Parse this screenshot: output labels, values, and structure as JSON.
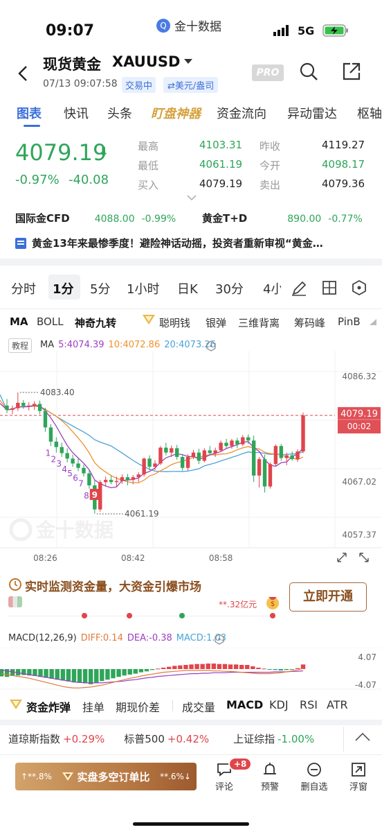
{
  "status_bar": {
    "time": "09:07",
    "app_name": "金十数据",
    "network": "5G"
  },
  "header": {
    "title": "现货黄金",
    "symbol": "XAUUSD",
    "datetime": "07/13 09:07:58",
    "trading_status": "交易中",
    "unit": "⇄美元/盎司",
    "pro_badge": "PRO"
  },
  "tabs": [
    "图表",
    "快讯",
    "头条",
    "盯盘神器",
    "资金流向",
    "异动雷达",
    "枢轴"
  ],
  "quote": {
    "price": "4079.19",
    "change_pct": "-0.97%",
    "change": "-40.08",
    "stats": [
      {
        "label": "最高",
        "value": "4103.31",
        "color": "green"
      },
      {
        "label": "昨收",
        "value": "4119.27",
        "color": "dark"
      },
      {
        "label": "最低",
        "value": "4061.19",
        "color": "green"
      },
      {
        "label": "今开",
        "value": "4098.17",
        "color": "green"
      },
      {
        "label": "买入",
        "value": "4079.19",
        "color": "dark"
      },
      {
        "label": "卖出",
        "value": "4079.36",
        "color": "dark"
      }
    ]
  },
  "related": [
    {
      "name": "国际金CFD",
      "price": "4088.00",
      "pct": "-0.99%"
    },
    {
      "name": "黄金T+D",
      "price": "890.00",
      "pct": "-0.77%"
    }
  ],
  "news_ticker": "黄金13年来最惨季度！避险神话动摇，投资者重新审视“黄金…",
  "timeframes": [
    "分时",
    "1分",
    "5分",
    "1小时",
    "日K",
    "30分",
    "4小"
  ],
  "active_timeframe": "1分",
  "indicators": [
    "MA",
    "BOLL",
    "神奇九转",
    "聪明钱",
    "银弹",
    "三维背离",
    "筹码峰",
    "PinB"
  ],
  "ma_legend": {
    "tutorial": "教程",
    "label": "MA",
    "ma5": "5:4074.39",
    "ma10": "10:4072.86",
    "ma20": "20:4073.26"
  },
  "chart_data": {
    "type": "candlestick",
    "timeframe": "1分",
    "x_ticks": [
      "08:26",
      "08:42",
      "08:58"
    ],
    "y_ticks": [
      "4086.32",
      "4067.02",
      "4057.37"
    ],
    "ylim": [
      4055.0,
      4091.0
    ],
    "current_price": "4079.19",
    "countdown": "00:02",
    "marked_high": "4083.40",
    "marked_low": "4061.19",
    "td_sequence_labels": [
      "1",
      "2",
      "3",
      "4",
      "5",
      "6",
      "7",
      "8",
      "9"
    ],
    "colors": {
      "up": "#e0454b",
      "down": "#2fa55a",
      "ma5": "#9b3fc0",
      "ma10": "#f0902c",
      "ma20": "#4aa3d8"
    },
    "candles": [
      [
        4081.0,
        4082.2,
        4079.6,
        4080.2
      ],
      [
        4080.2,
        4081.0,
        4079.4,
        4080.5
      ],
      [
        4080.5,
        4083.4,
        4080.0,
        4081.5
      ],
      [
        4081.5,
        4082.0,
        4080.4,
        4080.9
      ],
      [
        4080.9,
        4081.6,
        4080.1,
        4081.0
      ],
      [
        4081.0,
        4081.8,
        4080.2,
        4081.3
      ],
      [
        4081.3,
        4081.9,
        4079.4,
        4080.0
      ],
      [
        4080.0,
        4080.6,
        4076.2,
        4077.0
      ],
      [
        4077.0,
        4077.6,
        4073.6,
        4074.4
      ],
      [
        4074.4,
        4075.2,
        4072.4,
        4073.4
      ],
      [
        4073.4,
        4074.2,
        4071.6,
        4072.3
      ],
      [
        4072.3,
        4073.2,
        4070.6,
        4071.3
      ],
      [
        4071.3,
        4072.0,
        4069.8,
        4070.4
      ],
      [
        4070.4,
        4071.3,
        4069.0,
        4069.6
      ],
      [
        4069.6,
        4070.2,
        4068.0,
        4068.6
      ],
      [
        4068.6,
        4069.2,
        4065.8,
        4066.4
      ],
      [
        4066.4,
        4067.3,
        4061.2,
        4062.0
      ],
      [
        4062.0,
        4067.4,
        4061.6,
        4067.0
      ],
      [
        4067.0,
        4068.0,
        4066.2,
        4067.4
      ],
      [
        4067.4,
        4068.2,
        4066.6,
        4067.0
      ],
      [
        4067.0,
        4068.0,
        4066.1,
        4067.2
      ],
      [
        4067.2,
        4068.4,
        4066.7,
        4067.9
      ],
      [
        4067.9,
        4068.5,
        4066.4,
        4067.4
      ],
      [
        4067.4,
        4068.3,
        4066.6,
        4067.9
      ],
      [
        4067.9,
        4068.8,
        4067.0,
        4068.4
      ],
      [
        4068.4,
        4071.5,
        4068.0,
        4071.3
      ],
      [
        4071.3,
        4071.9,
        4069.2,
        4069.8
      ],
      [
        4069.8,
        4071.0,
        4069.2,
        4070.4
      ],
      [
        4070.4,
        4073.6,
        4070.1,
        4073.3
      ],
      [
        4073.3,
        4074.2,
        4071.9,
        4072.4
      ],
      [
        4072.4,
        4073.7,
        4071.6,
        4073.2
      ],
      [
        4073.2,
        4073.8,
        4071.1,
        4071.6
      ],
      [
        4071.6,
        4072.1,
        4069.1,
        4069.6
      ],
      [
        4069.6,
        4072.1,
        4069.1,
        4071.6
      ],
      [
        4071.6,
        4072.9,
        4071.2,
        4072.4
      ],
      [
        4072.4,
        4073.1,
        4070.3,
        4070.9
      ],
      [
        4070.9,
        4073.2,
        4070.6,
        4072.8
      ],
      [
        4072.8,
        4073.6,
        4071.8,
        4072.3
      ],
      [
        4072.3,
        4073.3,
        4071.6,
        4072.8
      ],
      [
        4072.8,
        4074.6,
        4072.5,
        4074.2
      ],
      [
        4074.2,
        4074.9,
        4073.2,
        4073.6
      ],
      [
        4073.6,
        4074.9,
        4073.1,
        4074.6
      ],
      [
        4074.6,
        4075.1,
        4073.2,
        4073.9
      ],
      [
        4073.9,
        4075.6,
        4073.6,
        4075.2
      ],
      [
        4075.2,
        4075.7,
        4074.0,
        4074.6
      ],
      [
        4074.6,
        4075.5,
        4067.0,
        4068.2
      ],
      [
        4068.2,
        4071.6,
        4066.0,
        4071.2
      ],
      [
        4071.2,
        4072.0,
        4065.1,
        4066.2
      ],
      [
        4066.2,
        4070.6,
        4065.8,
        4070.3
      ],
      [
        4070.3,
        4073.9,
        4070.0,
        4073.6
      ],
      [
        4073.6,
        4074.0,
        4070.9,
        4071.4
      ],
      [
        4071.4,
        4072.4,
        4070.1,
        4071.9
      ],
      [
        4071.9,
        4072.6,
        4070.9,
        4071.2
      ],
      [
        4071.2,
        4073.0,
        4070.7,
        4072.6
      ],
      [
        4072.6,
        4079.7,
        4072.3,
        4079.2
      ]
    ],
    "macd": {
      "label": "MACD(12,26,9)",
      "diff": "DIFF:0.14",
      "dea": "DEA:-0.38",
      "macd": "MACD:1.03",
      "y_ticks": [
        "4.07",
        "-4.07"
      ],
      "ylim": [
        -4.07,
        4.07
      ],
      "histogram": [
        -1.6,
        -1.7,
        -1.5,
        -1.4,
        -1.3,
        -1.4,
        -1.5,
        -1.7,
        -1.9,
        -2.1,
        -2.3,
        -2.5,
        -2.7,
        -2.9,
        -3.0,
        -3.1,
        -3.3,
        -3.0,
        -2.6,
        -2.3,
        -2.0,
        -1.7,
        -1.4,
        -1.2,
        -1.0,
        -0.7,
        -0.5,
        -0.2,
        0.1,
        0.3,
        0.5,
        0.7,
        0.8,
        0.9,
        1.0,
        1.1,
        1.1,
        1.2,
        1.2,
        1.1,
        1.1,
        1.0,
        1.0,
        0.9,
        0.9,
        0.6,
        0.3,
        0.1,
        -0.1,
        -0.2,
        -0.3,
        -0.2,
        -0.1,
        0.2,
        1.0
      ],
      "diff_values": [
        -1.0,
        -1.2,
        -1.4,
        -1.6,
        -1.8,
        -2.0,
        -2.3,
        -2.6,
        -2.9,
        -3.2,
        -3.5,
        -3.8,
        -4.0,
        -4.1,
        -4.1,
        -4.0,
        -3.9,
        -3.7,
        -3.5,
        -3.2,
        -2.9,
        -2.6,
        -2.3,
        -2.0,
        -1.8,
        -1.5,
        -1.3,
        -1.1,
        -0.9,
        -0.7,
        -0.6,
        -0.5,
        -0.4,
        -0.3,
        -0.3,
        -0.3,
        -0.3,
        -0.3,
        -0.4,
        -0.4,
        -0.5,
        -0.5,
        -0.6,
        -0.7,
        -0.8,
        -0.9,
        -1.0,
        -1.0,
        -1.0,
        -0.9,
        -0.8,
        -0.6,
        -0.4,
        -0.2,
        0.14
      ],
      "dea_values": [
        -0.2,
        -0.4,
        -0.6,
        -0.8,
        -1.0,
        -1.2,
        -1.4,
        -1.6,
        -1.8,
        -2.0,
        -2.2,
        -2.4,
        -2.6,
        -2.8,
        -2.9,
        -3.0,
        -3.0,
        -3.0,
        -3.0,
        -2.9,
        -2.8,
        -2.7,
        -2.6,
        -2.4,
        -2.3,
        -2.1,
        -1.9,
        -1.8,
        -1.6,
        -1.5,
        -1.4,
        -1.3,
        -1.2,
        -1.1,
        -1.0,
        -1.0,
        -0.9,
        -0.9,
        -0.8,
        -0.8,
        -0.8,
        -0.7,
        -0.7,
        -0.7,
        -0.7,
        -0.7,
        -0.7,
        -0.7,
        -0.7,
        -0.6,
        -0.6,
        -0.6,
        -0.5,
        -0.5,
        -0.38
      ]
    }
  },
  "promo": {
    "title": "实时监测资金量，大资金引爆市场",
    "amount": "**.32亿元",
    "button": "立即开通"
  },
  "bottom_indicators": [
    "资金炸弹",
    "挂单",
    "期现价差",
    "成交量",
    "MACD",
    "KDJ",
    "RSI",
    "ATR"
  ],
  "market_ticker": [
    {
      "name": "道琼斯指数",
      "value": "+0.29%"
    },
    {
      "name": "标普500",
      "value": "+0.42%"
    },
    {
      "name": "上证综指",
      "value": "-1.00%"
    }
  ],
  "bottom_bar": {
    "left_pct": "↑**.8%",
    "order_label": "实盘多空订单比",
    "right_pct": "**.6%↓",
    "comment_badge": "+8",
    "actions": [
      "评论",
      "预警",
      "删自选",
      "浮窗"
    ]
  }
}
